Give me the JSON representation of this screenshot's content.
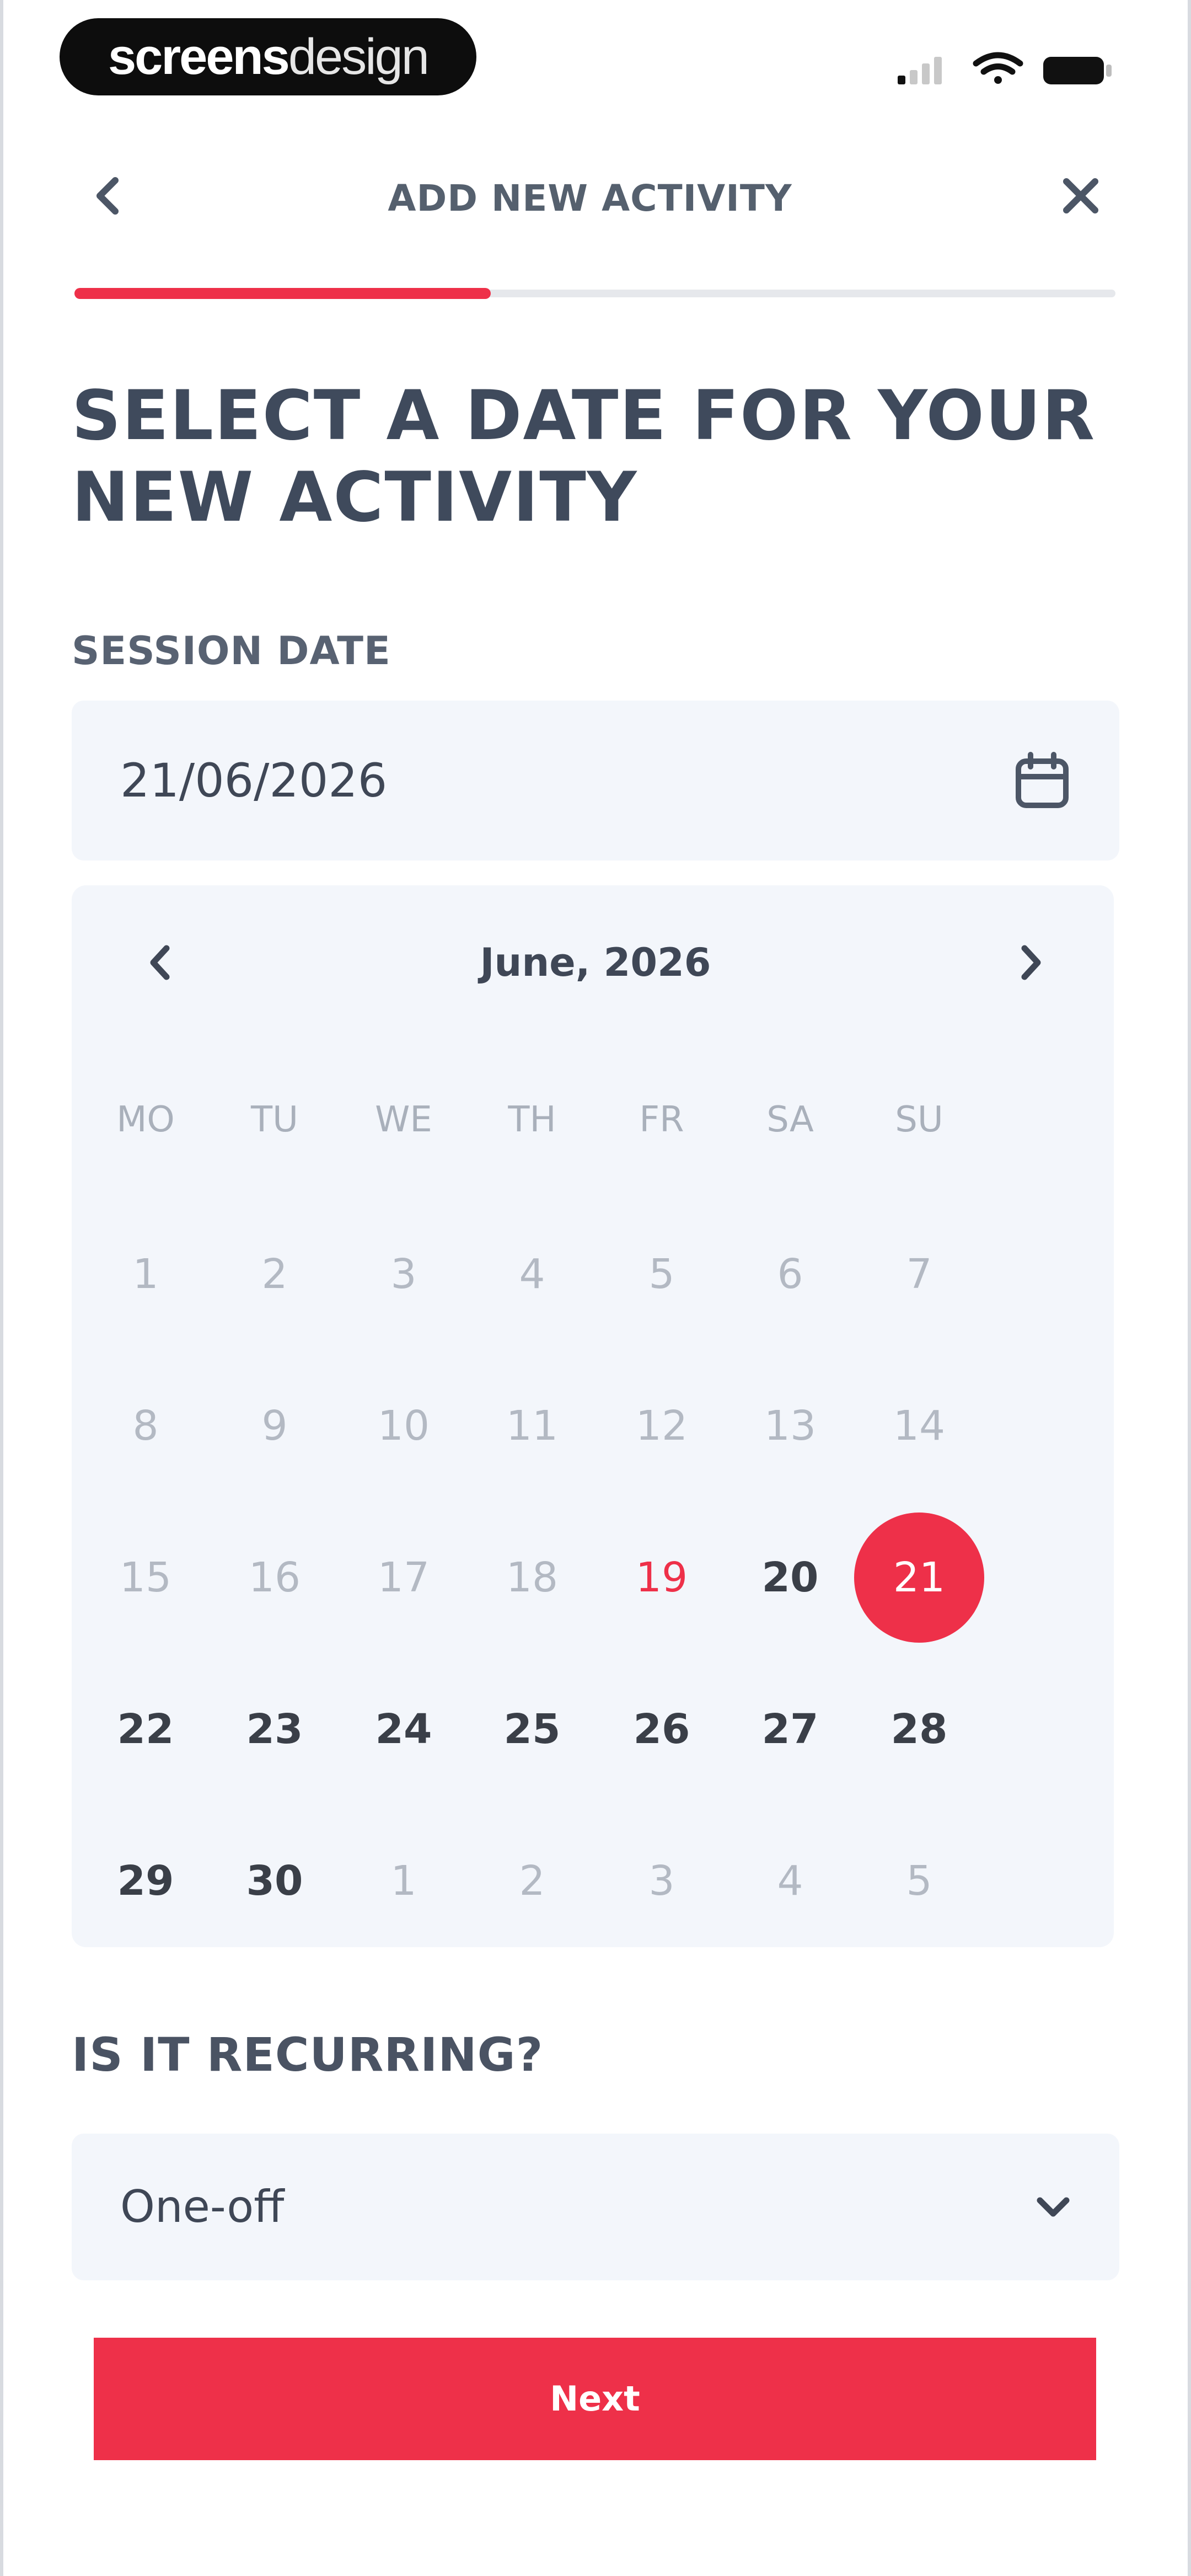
{
  "status_bar": {
    "logo_part1": "screens",
    "logo_part2": "design",
    "icons": [
      "signal-icon",
      "wifi-icon",
      "battery-icon"
    ]
  },
  "header": {
    "title": "ADD NEW ACTIVITY",
    "back_icon": "chevron-left-icon",
    "close_icon": "close-icon",
    "progress_fraction": 0.4
  },
  "page_title": "SELECT A DATE FOR YOUR NEW ACTIVITY",
  "session_date": {
    "label": "SESSION DATE",
    "value": "21/06/2026",
    "icon": "calendar-icon"
  },
  "calendar": {
    "month_label": "June, 2026",
    "weekdays": [
      "MO",
      "TU",
      "WE",
      "TH",
      "FR",
      "SA",
      "SU"
    ],
    "weeks": [
      [
        {
          "d": "1",
          "s": "muted"
        },
        {
          "d": "2",
          "s": "muted"
        },
        {
          "d": "3",
          "s": "muted"
        },
        {
          "d": "4",
          "s": "muted"
        },
        {
          "d": "5",
          "s": "muted"
        },
        {
          "d": "6",
          "s": "muted"
        },
        {
          "d": "7",
          "s": "muted"
        }
      ],
      [
        {
          "d": "8",
          "s": "muted"
        },
        {
          "d": "9",
          "s": "muted"
        },
        {
          "d": "10",
          "s": "muted"
        },
        {
          "d": "11",
          "s": "muted"
        },
        {
          "d": "12",
          "s": "muted"
        },
        {
          "d": "13",
          "s": "muted"
        },
        {
          "d": "14",
          "s": "muted"
        }
      ],
      [
        {
          "d": "15",
          "s": "muted"
        },
        {
          "d": "16",
          "s": "muted"
        },
        {
          "d": "17",
          "s": "muted"
        },
        {
          "d": "18",
          "s": "muted"
        },
        {
          "d": "19",
          "s": "today"
        },
        {
          "d": "20",
          "s": "bold"
        },
        {
          "d": "21",
          "s": "selected"
        }
      ],
      [
        {
          "d": "22",
          "s": "bold"
        },
        {
          "d": "23",
          "s": "bold"
        },
        {
          "d": "24",
          "s": "bold"
        },
        {
          "d": "25",
          "s": "bold"
        },
        {
          "d": "26",
          "s": "bold"
        },
        {
          "d": "27",
          "s": "bold"
        },
        {
          "d": "28",
          "s": "bold"
        }
      ],
      [
        {
          "d": "29",
          "s": "bold"
        },
        {
          "d": "30",
          "s": "bold"
        },
        {
          "d": "1",
          "s": "muted"
        },
        {
          "d": "2",
          "s": "muted"
        },
        {
          "d": "3",
          "s": "muted"
        },
        {
          "d": "4",
          "s": "muted"
        },
        {
          "d": "5",
          "s": "muted"
        }
      ]
    ]
  },
  "recurring": {
    "label": "IS IT RECURRING?",
    "value": "One-off",
    "icon": "chevron-down-icon"
  },
  "next_button": {
    "label": "Next"
  },
  "colors": {
    "accent": "#ee3049",
    "field_bg": "#f3f6fb",
    "text_dark": "#3f4756",
    "text_muted": "#b3b9c3"
  }
}
